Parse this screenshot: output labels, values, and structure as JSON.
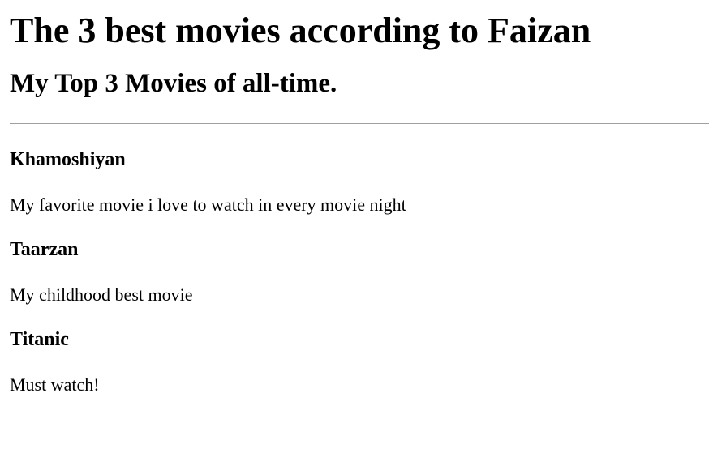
{
  "page": {
    "title": "The 3 best movies according to Faizan",
    "subtitle": "My Top 3 Movies of all-time."
  },
  "movies": [
    {
      "title": "Khamoshiyan",
      "description": "My favorite movie i love to watch in every movie night"
    },
    {
      "title": "Taarzan",
      "description": "My childhood best movie"
    },
    {
      "title": "Titanic",
      "description": "Must watch!"
    }
  ]
}
